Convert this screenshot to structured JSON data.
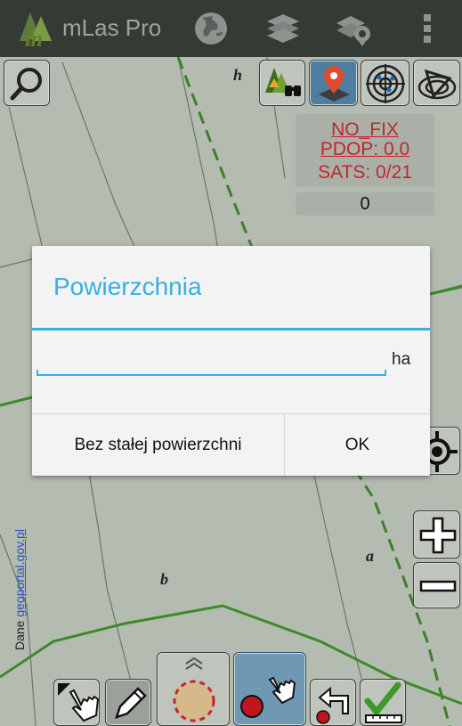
{
  "app": {
    "title": "mLas Pro"
  },
  "toolbar": {
    "icons": [
      "app-logo-icon",
      "globe-icon",
      "layers-icon",
      "map-layer-pin-icon",
      "overflow-menu-icon"
    ]
  },
  "gps_status": {
    "fix": "NO_FIX",
    "pdop": "PDOP: 0.0",
    "sats": "SATS: 0/21",
    "counter": "0"
  },
  "map": {
    "labels": {
      "h": "h",
      "a": "a",
      "b": "b"
    },
    "attribution_prefix": "Dane ",
    "attribution_link": "geoportal.gov.pl"
  },
  "dialog": {
    "title": "Powierzchnia",
    "input_value": "",
    "unit": "ha",
    "button_no_area": "Bez stałej powierzchni",
    "button_ok": "OK"
  },
  "colors": {
    "accent": "#36b1df",
    "status_red": "#c0272d",
    "actionbar": "#343a34",
    "map_background": "#b4bbb1",
    "active_tool": "#4d7ea0"
  }
}
